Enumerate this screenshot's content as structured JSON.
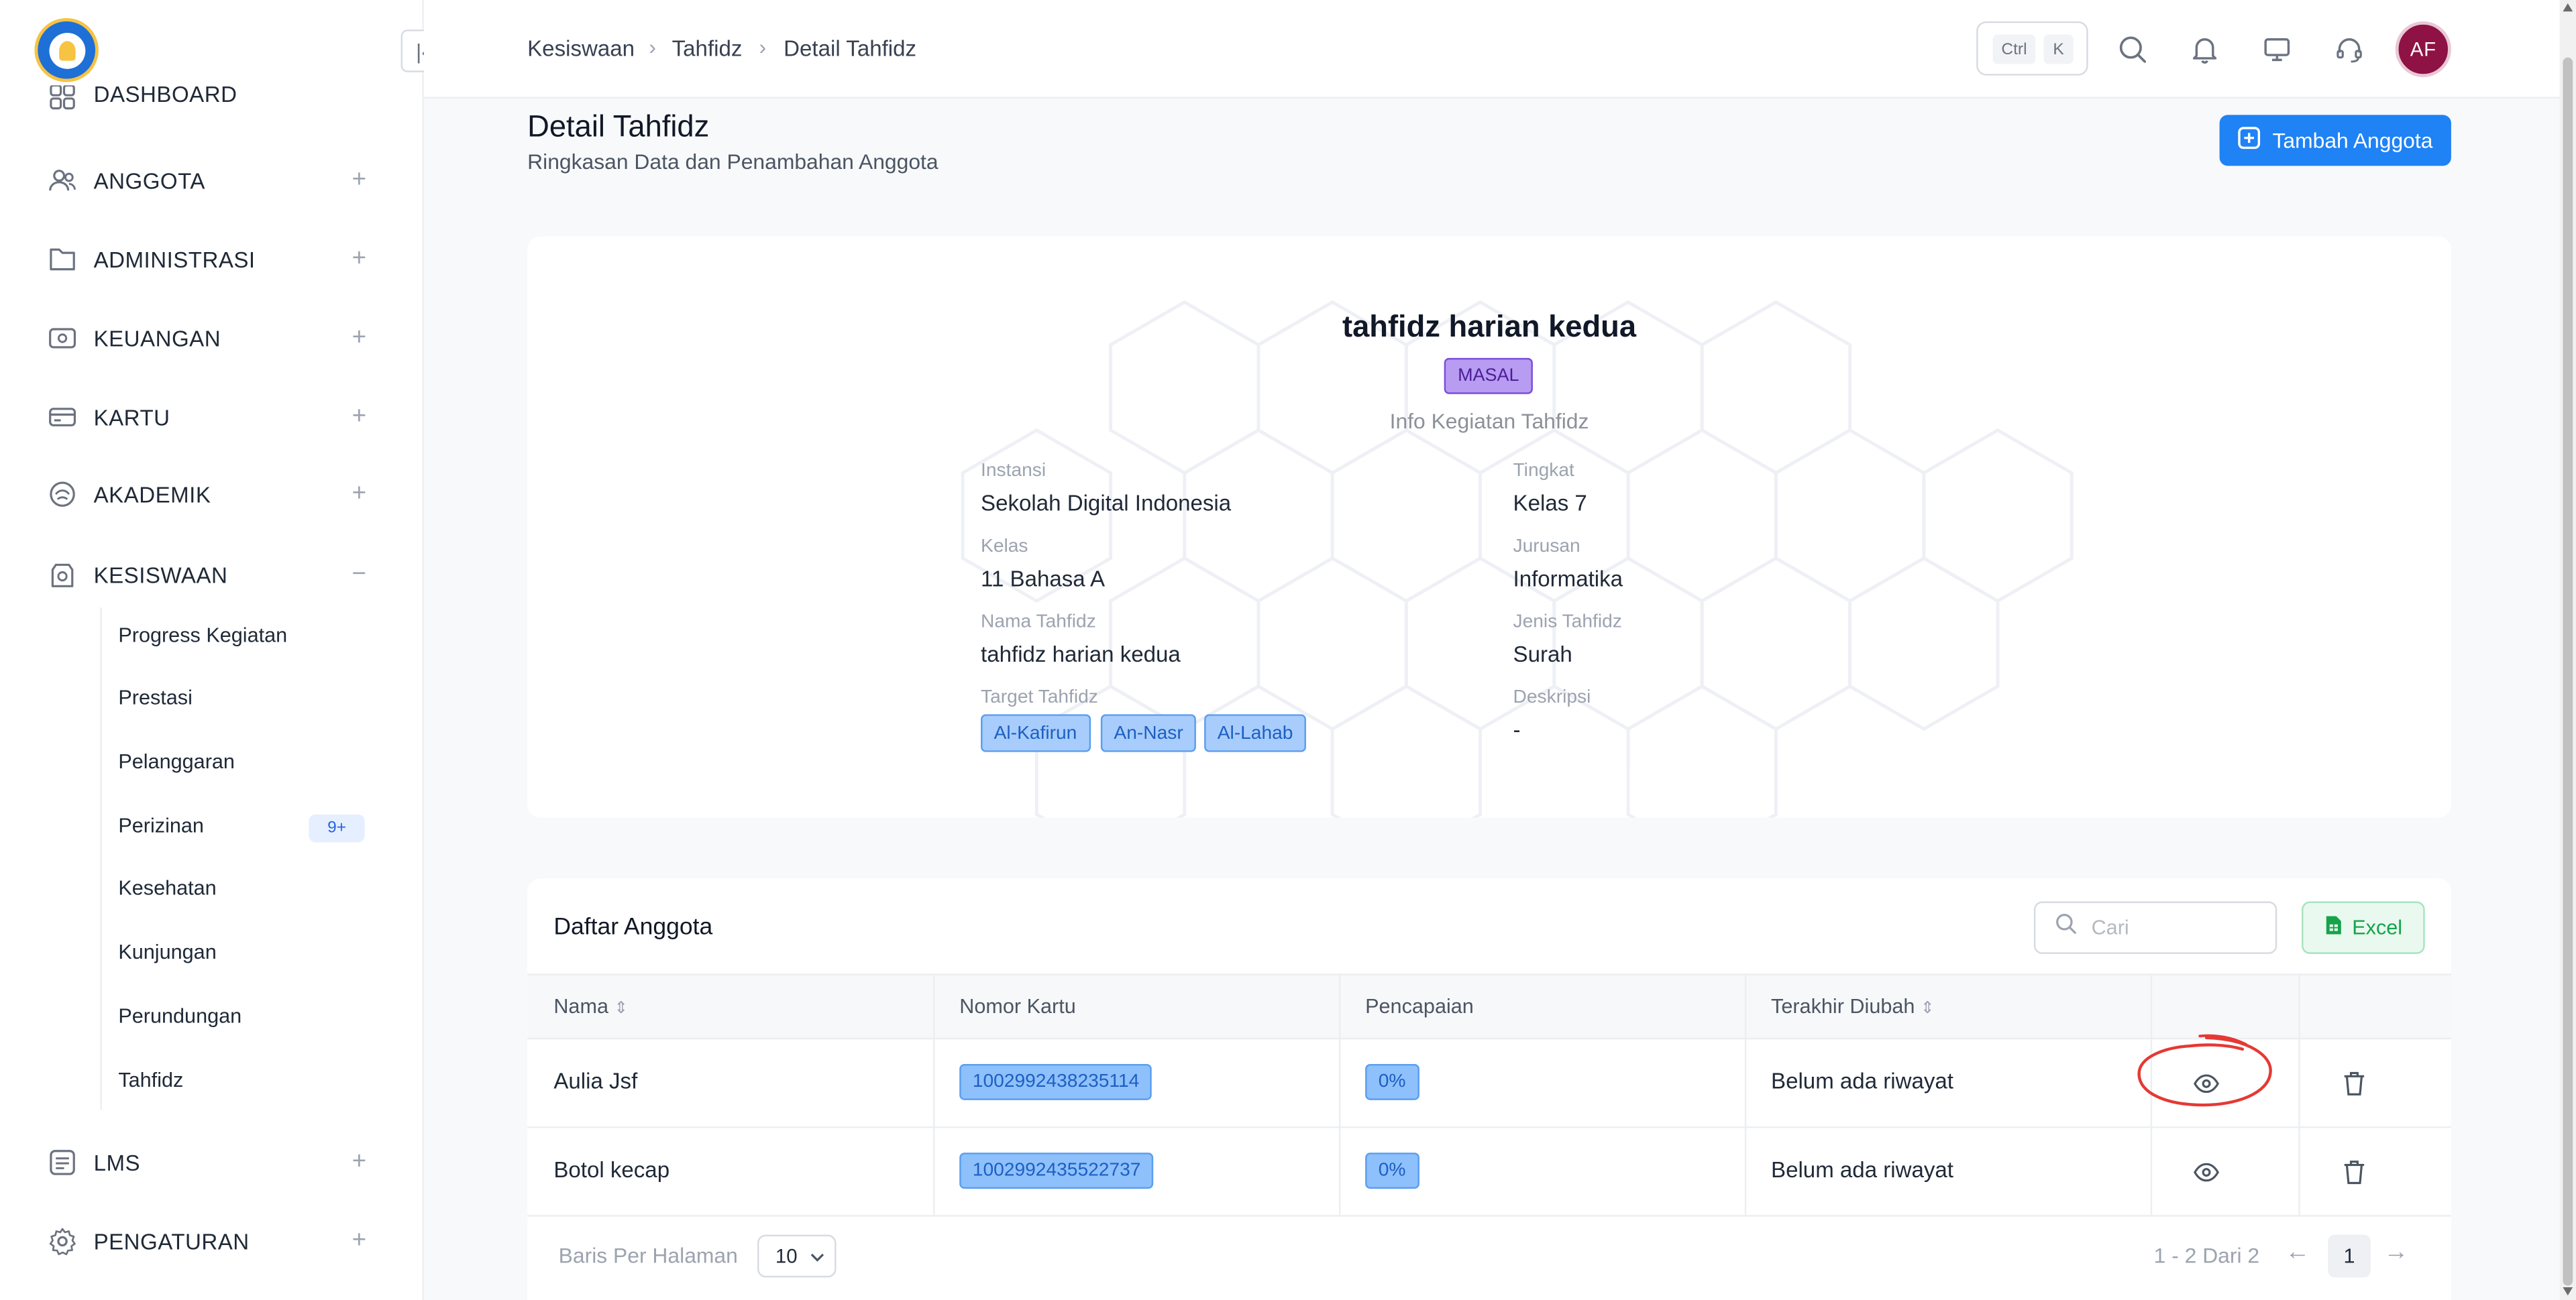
{
  "sidebar": {
    "items": [
      {
        "label": "DASHBOARD",
        "icon": "dashboard-icon"
      },
      {
        "label": "ANGGOTA",
        "icon": "users-icon"
      },
      {
        "label": "ADMINISTRASI",
        "icon": "folder-icon"
      },
      {
        "label": "KEUANGAN",
        "icon": "wallet-icon"
      },
      {
        "label": "KARTU",
        "icon": "card-icon"
      },
      {
        "label": "AKADEMIK",
        "icon": "academic-icon"
      },
      {
        "label": "KESISWAAN",
        "icon": "student-icon"
      },
      {
        "label": "LMS",
        "icon": "lms-icon"
      },
      {
        "label": "PENGATURAN",
        "icon": "gear-icon"
      }
    ],
    "subitems": [
      "Progress Kegiatan",
      "Prestasi",
      "Pelanggaran",
      "Perizinan",
      "Kesehatan",
      "Kunjungan",
      "Perundungan",
      "Tahfidz"
    ],
    "perizinan_badge": "9+"
  },
  "header": {
    "breadcrumb": [
      "Kesiswaan",
      "Tahfidz",
      "Detail Tahfidz"
    ],
    "kbd": [
      "Ctrl",
      "K"
    ],
    "avatar": "AF"
  },
  "page": {
    "title": "Detail Tahfidz",
    "subtitle": "Ringkasan Data dan Penambahan Anggota",
    "add_button": "Tambah Anggota"
  },
  "info": {
    "title": "tahfidz harian kedua",
    "badge": "MASAL",
    "subtitle": "Info Kegiatan Tahfidz",
    "fields": {
      "instansi_label": "Instansi",
      "instansi": "Sekolah Digital Indonesia",
      "tingkat_label": "Tingkat",
      "tingkat": "Kelas 7",
      "kelas_label": "Kelas",
      "kelas": "11 Bahasa A",
      "jurusan_label": "Jurusan",
      "jurusan": "Informatika",
      "nama_label": "Nama Tahfidz",
      "nama": "tahfidz harian kedua",
      "jenis_label": "Jenis Tahfidz",
      "jenis": "Surah",
      "target_label": "Target Tahfidz",
      "deskripsi_label": "Deskripsi",
      "deskripsi": "-"
    },
    "targets": [
      "Al-Kafirun",
      "An-Nasr",
      "Al-Lahab"
    ]
  },
  "table": {
    "title": "Daftar Anggota",
    "search_placeholder": "Cari",
    "excel_button": "Excel",
    "columns": [
      "Nama",
      "Nomor Kartu",
      "Pencapaian",
      "Terakhir Diubah"
    ],
    "rows": [
      {
        "nama": "Aulia Jsf",
        "nomor_kartu": "1002992438235114",
        "pencapaian": "0%",
        "terakhir": "Belum ada riwayat"
      },
      {
        "nama": "Botol kecap",
        "nomor_kartu": "1002992435522737",
        "pencapaian": "0%",
        "terakhir": "Belum ada riwayat"
      }
    ],
    "footer": {
      "per_page_label": "Baris Per Halaman",
      "per_page_value": "10",
      "page_info": "1 - 2 Dari 2",
      "current_page": "1"
    }
  },
  "colors": {
    "primary": "#1f82f5",
    "masal_badge": "#b79cf2",
    "excel_green": "#16a34a",
    "annotation_red": "#e53935",
    "avatar_bg": "#8e1244"
  }
}
